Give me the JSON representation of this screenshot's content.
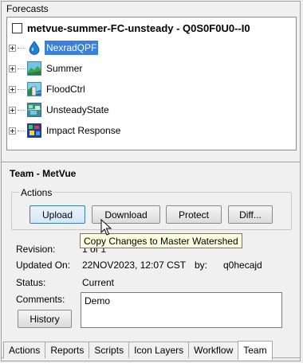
{
  "forecasts": {
    "title": "Forecasts",
    "root_label": "metvue-summer-FC-unsteady - Q0S0F0U0--I0",
    "items": [
      {
        "label": "NexradQPF",
        "icon": "water-drop-icon",
        "selected": true
      },
      {
        "label": "Summer",
        "icon": "landscape-icon",
        "selected": false
      },
      {
        "label": "FloodCtrl",
        "icon": "flood-control-icon",
        "selected": false
      },
      {
        "label": "UnsteadyState",
        "icon": "unsteady-state-icon",
        "selected": false
      },
      {
        "label": "Impact Response",
        "icon": "impact-response-icon",
        "selected": false
      }
    ]
  },
  "team": {
    "title": "Team - MetVue",
    "actions_legend": "Actions",
    "buttons": {
      "upload": "Upload",
      "download": "Download",
      "protect": "Protect",
      "diff": "Diff..."
    },
    "tooltip": "Copy Changes to Master Watershed",
    "revision_label": "Revision:",
    "revision_value": "1 of 1",
    "updated_label": "Updated On:",
    "updated_value": "22NOV2023, 12:07 CST",
    "by_label": "by:",
    "by_value": "q0hecajd",
    "status_label": "Status:",
    "status_value": "Current",
    "comments_label": "Comments:",
    "comments_value": "Demo",
    "history_button": "History"
  },
  "tabs": [
    "Actions",
    "Reports",
    "Scripts",
    "Icon Layers",
    "Workflow",
    "Team"
  ],
  "active_tab": "Team",
  "colors": {
    "selection": "#3a7fd9",
    "tooltip_bg": "#ffffe1",
    "panel_bg": "#f0f0f0"
  }
}
